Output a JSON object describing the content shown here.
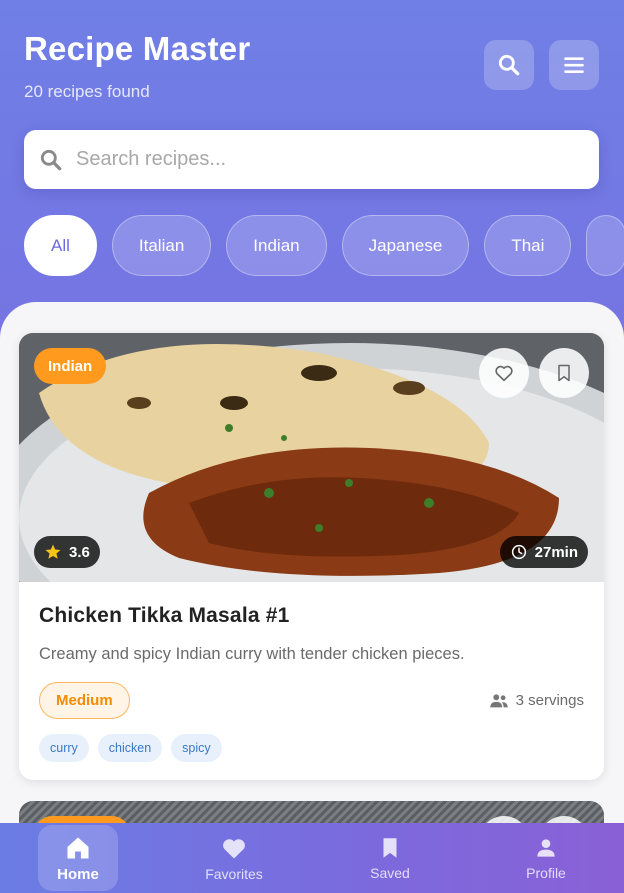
{
  "header": {
    "title": "Recipe Master",
    "results": "20 recipes found",
    "search_icon": "search-icon",
    "menu_icon": "menu-icon"
  },
  "search": {
    "placeholder": "Search recipes...",
    "value": ""
  },
  "filters": {
    "selected": "All",
    "items": [
      "All",
      "Italian",
      "Indian",
      "Japanese",
      "Thai"
    ]
  },
  "recipe": {
    "cuisine": "Indian",
    "rating": "3.6",
    "time": "27min",
    "title": "Chicken Tikka Masala #1",
    "description": "Creamy and spicy Indian curry with tender chicken pieces.",
    "difficulty": "Medium",
    "servings": "3 servings",
    "tags": [
      "curry",
      "chicken",
      "spicy"
    ]
  },
  "bottom_nav": {
    "items": [
      {
        "label": "Home",
        "icon": "home-icon",
        "active": true
      },
      {
        "label": "Favorites",
        "icon": "heart-icon",
        "active": false
      },
      {
        "label": "Saved",
        "icon": "bookmark-icon",
        "active": false
      },
      {
        "label": "Profile",
        "icon": "person-icon",
        "active": false
      }
    ]
  },
  "colors": {
    "accent": "#6a6be0",
    "badge": "#ff9a1f",
    "difficulty": "#f28c00",
    "tag_text": "#3a78c6"
  }
}
